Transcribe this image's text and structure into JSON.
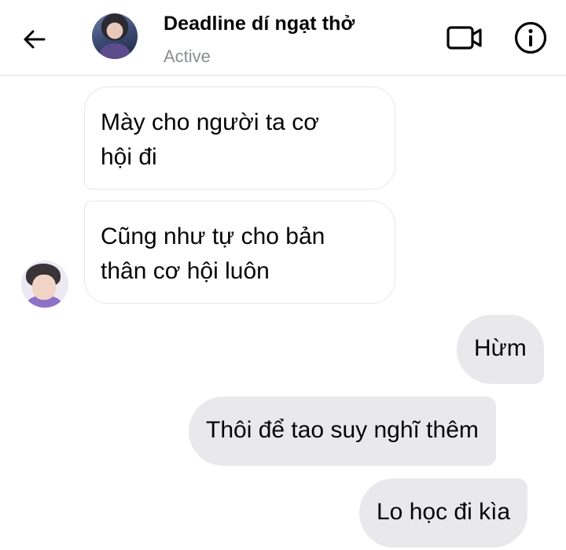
{
  "header": {
    "title": "Deadline dí ngạt thở",
    "status": "Active",
    "icons": [
      "back-arrow-icon",
      "video-call-icon",
      "info-icon"
    ]
  },
  "messages": [
    {
      "direction": "incoming",
      "text": "Mày cho người ta cơ\nhội đi"
    },
    {
      "direction": "incoming",
      "text": "Cũng như tự cho bản\nthân cơ hội luôn"
    },
    {
      "direction": "outgoing",
      "text": "Hừm"
    },
    {
      "direction": "outgoing",
      "text": "Thôi để tao suy nghĩ thêm"
    },
    {
      "direction": "outgoing",
      "text": "Lo học đi kìa"
    }
  ],
  "colors": {
    "incoming_bubble": "#ffffff",
    "incoming_border": "#e6e7ea",
    "outgoing_bubble": "#e9e9eb",
    "text": "#050505",
    "muted": "#8a8d91"
  }
}
